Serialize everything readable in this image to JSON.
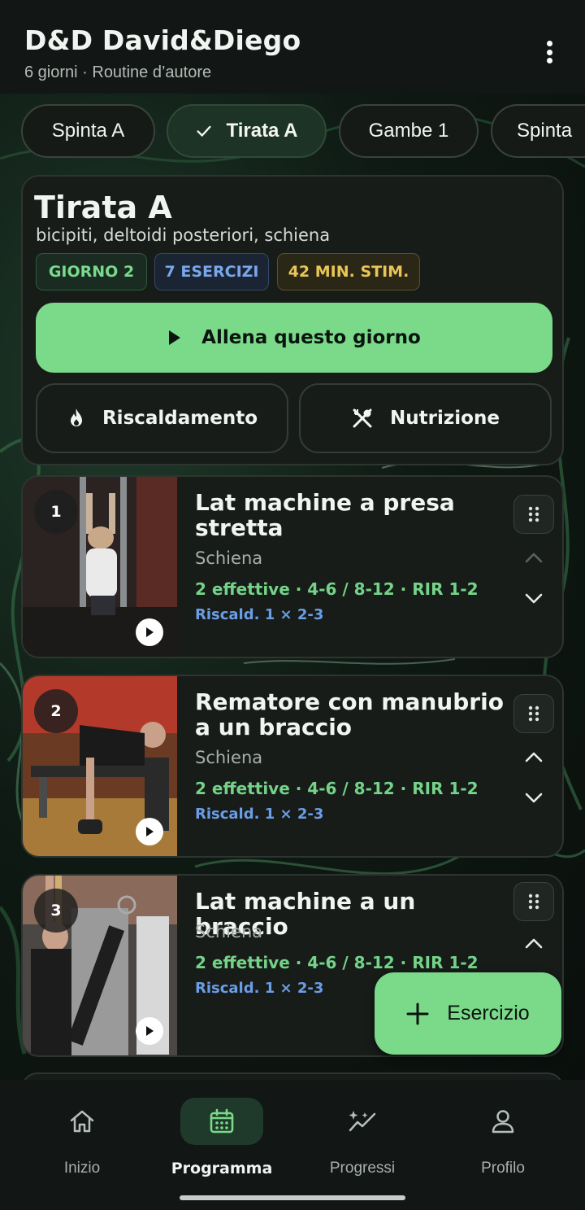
{
  "header": {
    "title": "D&D David&Diego",
    "subtitle": "6 giorni · Routine d’autore",
    "menu_icon": "more-vert-icon"
  },
  "tabs": [
    {
      "label": "Spinta A",
      "active": false
    },
    {
      "label": "Tirata A",
      "active": true
    },
    {
      "label": "Gambe 1",
      "active": false
    },
    {
      "label": "Spinta",
      "active": false
    }
  ],
  "day": {
    "title": "Tirata A",
    "muscles": "bicipiti, deltoidi posteriori, schiena",
    "badges": {
      "day": "GIORNO 2",
      "exercises": "7 ESERCIZI",
      "duration": "42 MIN. STIM."
    },
    "train_label": "Allena questo giorno",
    "warmup_label": "Riscaldamento",
    "nutrition_label": "Nutrizione"
  },
  "exercises": [
    {
      "number": "1",
      "name": "Lat machine a presa stretta",
      "muscle": "Schiena",
      "sets": "2 effettive · 4-6 / 8-12 · RIR 1-2",
      "warmup": "Riscald. 1 × 2-3"
    },
    {
      "number": "2",
      "name": "Rematore con manubrio a un braccio",
      "muscle": "Schiena",
      "sets": "2 effettive · 4-6 / 8-12 · RIR 1-2",
      "warmup": "Riscald. 1 × 2-3"
    },
    {
      "number": "3",
      "name": "Lat machine a un braccio",
      "muscle": "Schiena",
      "sets": "2 effettive · 4-6 / 8-12 · RIR 1-2",
      "warmup": "Riscald. 1 × 2-3"
    }
  ],
  "fab": {
    "label": "Esercizio"
  },
  "nav": [
    {
      "label": "Inizio",
      "icon": "home-icon",
      "active": false
    },
    {
      "label": "Programma",
      "icon": "calendar-icon",
      "active": true
    },
    {
      "label": "Progressi",
      "icon": "sparkle-trend-icon",
      "active": false
    },
    {
      "label": "Profilo",
      "icon": "person-icon",
      "active": false
    }
  ],
  "colors": {
    "accent": "#7ada8a",
    "background": "#0d110f",
    "card": "#171c19",
    "blue": "#6b9de6",
    "yellow": "#e9c558"
  }
}
